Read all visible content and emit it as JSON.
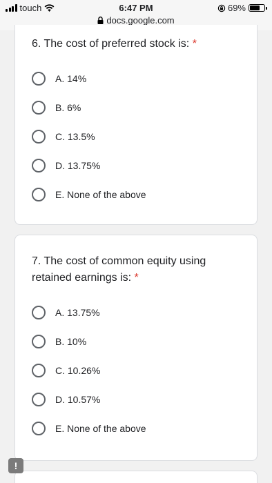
{
  "status_bar": {
    "carrier": "touch",
    "time": "6:47 PM",
    "url": "docs.google.com",
    "battery": "69%",
    "battery_level": 0.69
  },
  "questions": [
    {
      "text": "6. The cost of preferred stock is:",
      "required_mark": "*",
      "options": [
        "A. 14%",
        "B. 6%",
        "C. 13.5%",
        "D. 13.75%",
        "E. None of the above"
      ]
    },
    {
      "text": "7. The cost of common equity using retained earnings is:",
      "required_mark": "*",
      "options": [
        "A. 13.75%",
        "B. 10%",
        "C. 10.26%",
        "D. 10.57%",
        "E. None of the above"
      ]
    }
  ],
  "report_button": {
    "label": "!"
  },
  "colors": {
    "required": "#d93025",
    "radio_border": "#5f6368",
    "card_border": "#dadce0"
  }
}
